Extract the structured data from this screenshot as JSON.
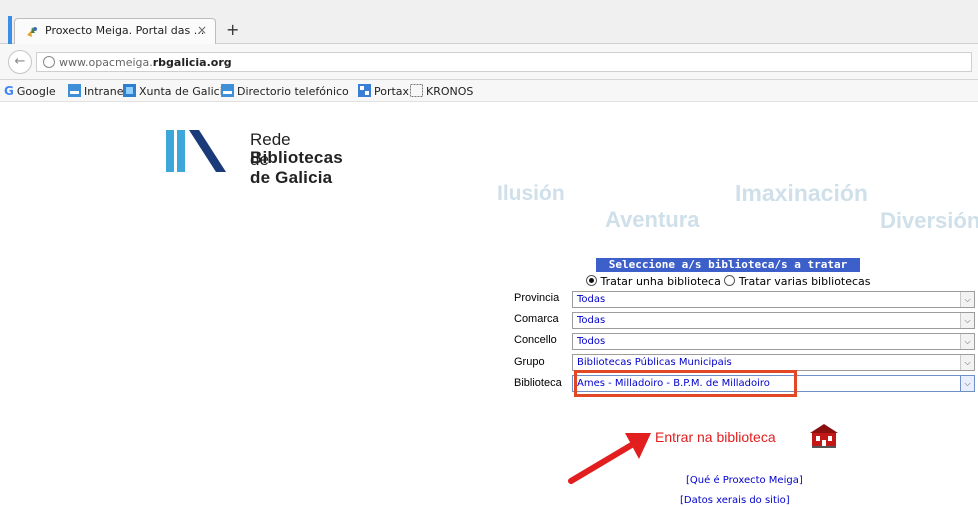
{
  "browser": {
    "tab_title": "Proxecto Meiga. Portal das ...",
    "tab_close": "×",
    "new_tab": "+",
    "back_icon": "back-arrow-icon",
    "url_prefix": "www.opacmeiga.",
    "url_domain": "rbgalicia.org"
  },
  "bookmarks": [
    {
      "label": "Google",
      "icon": "google-icon"
    },
    {
      "label": "Intranet",
      "icon": "net-icon"
    },
    {
      "label": "Xunta de Galicia",
      "icon": "xunta-icon"
    },
    {
      "label": "Directorio telefónico",
      "icon": "net-icon"
    },
    {
      "label": "Portax",
      "icon": "portax-icon"
    },
    {
      "label": "KRONOS",
      "icon": "kronos-icon"
    }
  ],
  "logo": {
    "line1": "Rede de",
    "line2": "Bibliotecas de Galicia",
    "colors": {
      "bar1": "#3ea6d8",
      "bar2": "#3ea6d8",
      "bar3": "#1b3a7a"
    }
  },
  "words": [
    "Ilusión",
    "Imaxinación",
    "Aventura",
    "Diversión"
  ],
  "form": {
    "title": "Seleccione a/s biblioteca/s a tratar",
    "radio_single": "Tratar unha biblioteca",
    "radio_multi": "Tratar varias bibliotecas",
    "rows": [
      {
        "label": "Provincia",
        "value": "Todas"
      },
      {
        "label": "Comarca",
        "value": "Todas"
      },
      {
        "label": "Concello",
        "value": "Todos"
      },
      {
        "label": "Grupo",
        "value": "Bibliotecas Públicas Municipais"
      },
      {
        "label": "Biblioteca",
        "value": "Ames - Milladoiro - B.P.M. de Milladoiro"
      }
    ],
    "enter_label": "Entrar na biblioteca",
    "link_about": "[Qué é Proxecto Meiga]",
    "link_data": "[Datos xerais do sitio]"
  },
  "colors": {
    "accent_title_bg": "#3d5fc9",
    "highlight_border": "#e24826",
    "enter_text": "#e21e1e",
    "link": "#0000cc",
    "watermark_words": "#cfe0ea"
  }
}
